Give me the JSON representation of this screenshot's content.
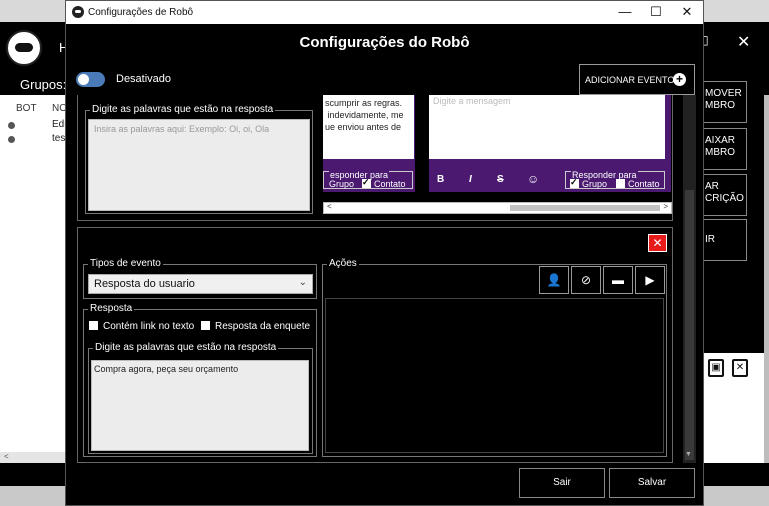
{
  "background_app": {
    "title_fragment": "H",
    "close_glyph": "✕",
    "groups_label": "Grupos:",
    "list_headers": [
      "BOT",
      "NO"
    ],
    "list_rows": [
      {
        "text": "Edi"
      },
      {
        "text": "test"
      }
    ],
    "right_buttons": [
      {
        "label": "MOVER\nMBRO"
      },
      {
        "label": "AIXAR\nMBRO"
      },
      {
        "label": "AR\nCRIÇÃO"
      },
      {
        "label": "IR"
      }
    ]
  },
  "window": {
    "title": "Configurações de Robô",
    "minimize_glyph": "—",
    "maximize_glyph": "☐",
    "close_glyph": "✕"
  },
  "dialog": {
    "heading": "Configurações do Robô",
    "toggle_label": "Desativado",
    "add_event_label": "ADICIONAR EVENTO",
    "add_event_icon": "+"
  },
  "event1": {
    "keywords_legend": "Digite as palavras que estão na resposta",
    "keywords_placeholder": "Insira as palavras aqui: Exemplo: Oi, oi, Ola",
    "message1_text": "scumprir as regras.\n indevidamente, me\nue enviou antes de",
    "respond_to_1": "esponder para",
    "group_label_1": "Grupo",
    "contact_label_1": "Contato",
    "message2_placeholder": "Digite a mensagem",
    "format_bold": "B",
    "format_italic": "I",
    "format_strike": "S",
    "format_emoji": "☺",
    "respond_to_2": "Responder para",
    "group_label_2": "Grupo",
    "contact_label_2": "Contato",
    "scroll_left": "<",
    "scroll_right": ">"
  },
  "event2": {
    "delete_glyph": "✕",
    "event_types_legend": "Tipos de evento",
    "event_type_selected": "Resposta do usuario",
    "caret": "⌄",
    "response_legend": "Resposta",
    "contains_link_label": "Contém link no texto",
    "poll_response_label": "Resposta da enquete",
    "keywords_legend": "Digite as palavras que estão na resposta",
    "keywords_value": "Compra agora, peça seu orçamento",
    "actions_legend": "Ações",
    "action_icons": [
      "user-remove-icon",
      "image-off-icon",
      "message-icon",
      "video-icon"
    ]
  },
  "footer": {
    "exit_label": "Sair",
    "save_label": "Salvar"
  },
  "colors": {
    "accent_purple": "#4b1a70",
    "toggle_blue": "#4a7ab8",
    "delete_red": "#e81b1b"
  }
}
